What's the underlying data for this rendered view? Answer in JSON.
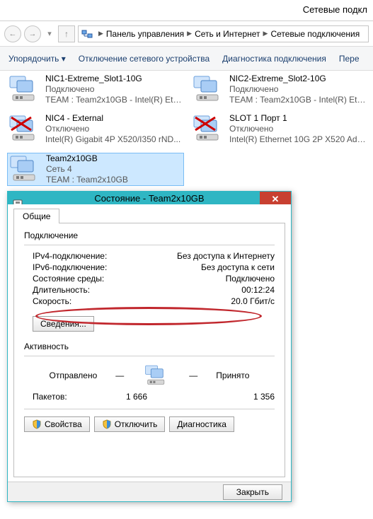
{
  "window": {
    "title": "Сетевые подкл"
  },
  "breadcrumb": {
    "items": [
      "Панель управления",
      "Сеть и Интернет",
      "Сетевые подключения"
    ]
  },
  "toolbar": {
    "organize": "Упорядочить",
    "disable": "Отключение сетевого устройства",
    "diag": "Диагностика подключения",
    "rename": "Пере"
  },
  "adapters": [
    {
      "name": "NIC1-Extreme_Slot1-10G",
      "status": "Подключено",
      "desc": "TEAM : Team2x10GB - Intel(R) Eth..."
    },
    {
      "name": "NIC2-Extreme_Slot2-10G",
      "status": "Подключено",
      "desc": "TEAM : Team2x10GB - Intel(R) Eth..."
    },
    {
      "name": "NIC4 - External",
      "status": "Отключено",
      "desc": "Intel(R) Gigabit 4P X520/I350 rND..."
    },
    {
      "name": "SLOT 1 Порт 1",
      "status": "Отключено",
      "desc": "Intel(R) Ethernet 10G 2P X520 Ada..."
    },
    {
      "name": "Team2x10GB",
      "status": "Сеть  4",
      "desc": "TEAM : Team2x10GB"
    }
  ],
  "dialog": {
    "title": "Состояние - Team2x10GB",
    "tab": "Общие",
    "group_conn": "Подключение",
    "rows_conn": {
      "ipv4_k": "IPv4-подключение:",
      "ipv4_v": "Без доступа к Интернету",
      "ipv6_k": "IPv6-подключение:",
      "ipv6_v": "Без доступа к сети",
      "media_k": "Состояние среды:",
      "media_v": "Подключено",
      "dur_k": "Длительность:",
      "dur_v": "00:12:24",
      "speed_k": "Скорость:",
      "speed_v": "20.0 Гбит/с"
    },
    "details_btn": "Сведения...",
    "group_act": "Активность",
    "act_sent": "Отправлено",
    "act_recv": "Принято",
    "packets_k": "Пакетов:",
    "packets_sent": "1 666",
    "packets_recv": "1 356",
    "btn_props": "Свойства",
    "btn_disable": "Отключить",
    "btn_diag": "Диагностика",
    "btn_close": "Закрыть"
  }
}
